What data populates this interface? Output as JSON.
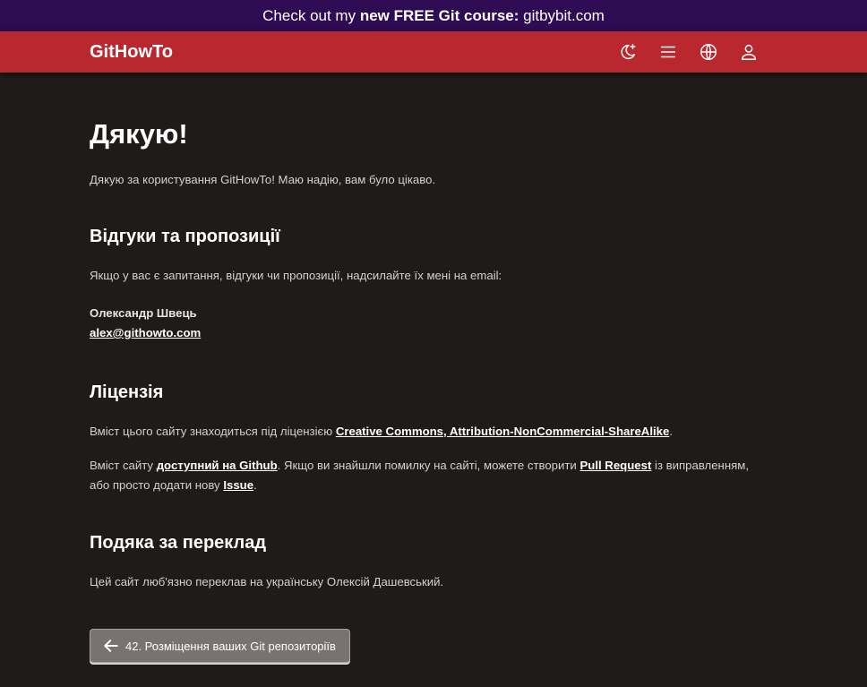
{
  "promo": {
    "prefix": "Check out my ",
    "bold": "new FREE Git course:",
    "suffix": " gitbybit.com"
  },
  "header": {
    "brand_bold": "Git",
    "brand_rest": "HowTo",
    "icons": [
      "theme-toggle-icon",
      "menu-icon",
      "globe-icon",
      "user-icon"
    ]
  },
  "page": {
    "title": "Дякую!",
    "intro": "Дякую за користування GitHowTo! Маю надію, вам було цікаво.",
    "feedback": {
      "heading": "Відгуки та пропозиції",
      "text": "Якщо у вас є запитання, відгуки чи пропозиції, надсилайте їх мені на email:",
      "author": "Олександр Швець",
      "email": "alex@githowto.com"
    },
    "license": {
      "heading": "Ліцензія",
      "p1_before": "Вміст цього сайту знаходиться під ліцензією ",
      "p1_link": "Creative Commons, Attribution-NonCommercial-ShareAlike",
      "p1_after": ".",
      "p2_before": "Вміст сайту ",
      "p2_link1": "доступний на Github",
      "p2_mid1": ". Якщо ви знайшли помилку на сайті, можете створити ",
      "p2_link2": "Pull Request",
      "p2_mid2": " із виправленням, або просто додати нову ",
      "p2_link3": "Issue",
      "p2_after": "."
    },
    "translation": {
      "heading": "Подяка за переклад",
      "text": "Цей сайт люб'язно переклав на українську Олексій Дашевський."
    },
    "prev_button": "42. Розміщення ваших Git репозиторіїв"
  },
  "colors": {
    "promo_bg": "#2e0b52",
    "navbar_bg": "#b8282e",
    "page_bg": "#1f1b19",
    "button_bg": "#787270"
  }
}
